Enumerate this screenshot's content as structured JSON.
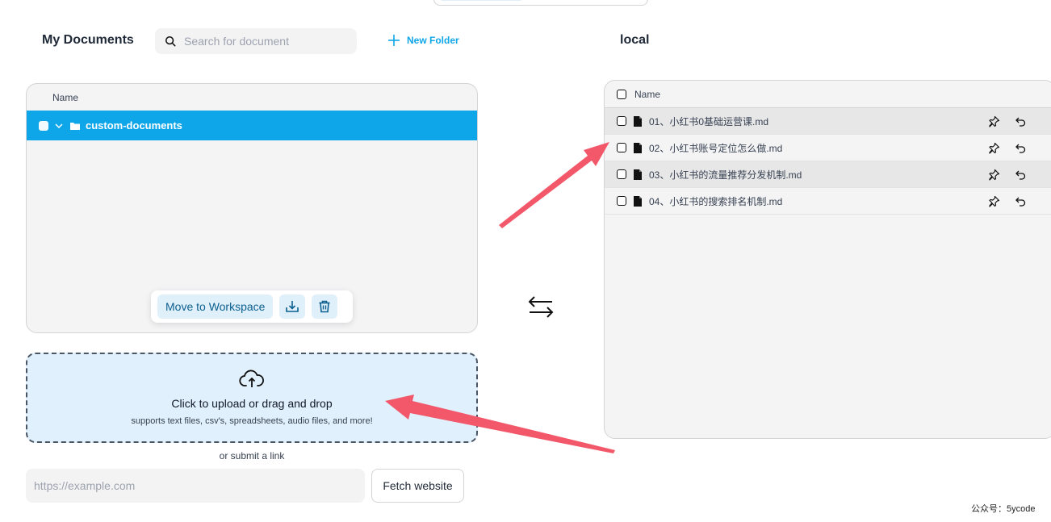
{
  "left": {
    "title": "My Documents",
    "search_placeholder": "Search for document",
    "new_folder_label": "New Folder",
    "table_header": "Name",
    "folder_name": "custom-documents",
    "move_label": "Move to Workspace"
  },
  "upload": {
    "title": "Click to upload or drag and drop",
    "subtitle": "supports text files, csv's, spreadsheets, audio files, and more!",
    "or_link": "or submit a link",
    "url_placeholder": "https://example.com",
    "fetch_label": "Fetch website"
  },
  "right": {
    "title": "local",
    "table_header": "Name",
    "files": [
      "01、小红书0基础运营课.md",
      "02、小红书账号定位怎么做.md",
      "03、小红书的流量推荐分发机制.md",
      "04、小红书的搜索排名机制.md"
    ]
  },
  "watermark": "公众号：5ycode",
  "colors": {
    "accent": "#0ea5e9",
    "arrow": "#f2586a",
    "upload_bg": "#e0f0fc"
  }
}
